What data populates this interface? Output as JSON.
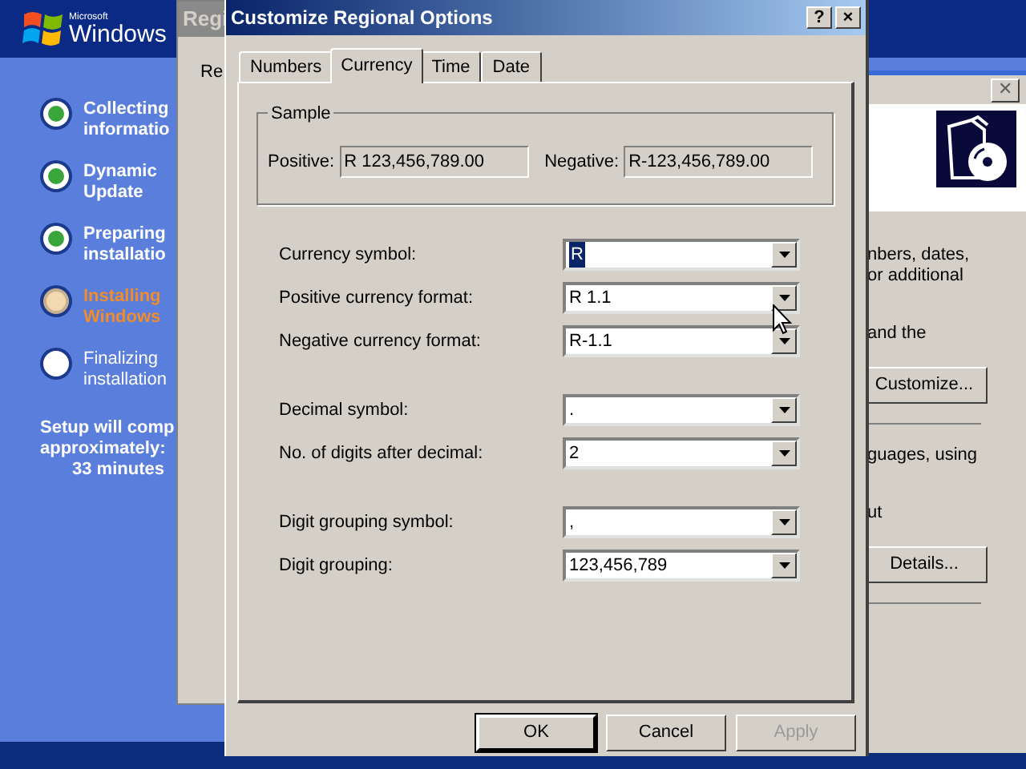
{
  "setup_screen": {
    "logo": {
      "maker": "Microsoft",
      "name": "Windows"
    },
    "steps": [
      {
        "lines": [
          "Collecting",
          "informatio"
        ],
        "completed": true,
        "current": false
      },
      {
        "lines": [
          "Dynamic",
          "Update"
        ],
        "completed": true,
        "current": false
      },
      {
        "lines": [
          "Preparing",
          "installatio"
        ],
        "completed": true,
        "current": false
      },
      {
        "lines": [
          "Installing",
          "Windows"
        ],
        "completed": false,
        "current": true
      },
      {
        "lines": [
          "Finalizing",
          "installation"
        ],
        "completed": false,
        "current": false
      }
    ],
    "estimate": [
      "Setup will comp",
      "approximately:",
      "33 minutes"
    ]
  },
  "back_window": {
    "title": "Regi",
    "tab": "Re"
  },
  "wizard_window": {
    "close": "✕",
    "items": [
      {
        "kind": "text",
        "text": "nbers, dates,"
      },
      {
        "kind": "text",
        "text": "or additional"
      },
      {
        "kind": "gap"
      },
      {
        "kind": "text",
        "text": "and the"
      },
      {
        "kind": "button",
        "text": "Customize..."
      },
      {
        "kind": "rule"
      },
      {
        "kind": "text",
        "text": "guages, using"
      },
      {
        "kind": "gap"
      },
      {
        "kind": "text",
        "text": "ut"
      },
      {
        "kind": "button",
        "text": "Details..."
      },
      {
        "kind": "rule"
      }
    ]
  },
  "dialog": {
    "title": "Customize Regional Options",
    "help": "?",
    "close": "×",
    "tabs": [
      {
        "label": "Numbers",
        "selected": false
      },
      {
        "label": "Currency",
        "selected": true
      },
      {
        "label": "Time",
        "selected": false
      },
      {
        "label": "Date",
        "selected": false
      }
    ],
    "sample": {
      "title": "Sample",
      "positive_label": "Positive:",
      "positive": "R 123,456,789.00",
      "negative_label": "Negative:",
      "negative": "R-123,456,789.00"
    },
    "field_groups": [
      [
        {
          "label": "Currency symbol:",
          "value": "R",
          "text_selected": true
        },
        {
          "label": "Positive currency format:",
          "value": "R 1.1",
          "text_selected": false
        },
        {
          "label": "Negative currency format:",
          "value": "R-1.1",
          "text_selected": false
        }
      ],
      [
        {
          "label": "Decimal symbol:",
          "value": ".",
          "text_selected": false
        },
        {
          "label": "No. of digits after decimal:",
          "value": "2",
          "text_selected": false
        }
      ],
      [
        {
          "label": "Digit grouping symbol:",
          "value": ",",
          "text_selected": false
        },
        {
          "label": "Digit grouping:",
          "value": "123,456,789",
          "text_selected": false
        }
      ]
    ],
    "buttons": [
      {
        "label": "OK",
        "default": true,
        "disabled": false
      },
      {
        "label": "Cancel",
        "default": false,
        "disabled": false
      },
      {
        "label": "Apply",
        "default": false,
        "disabled": true
      }
    ]
  }
}
